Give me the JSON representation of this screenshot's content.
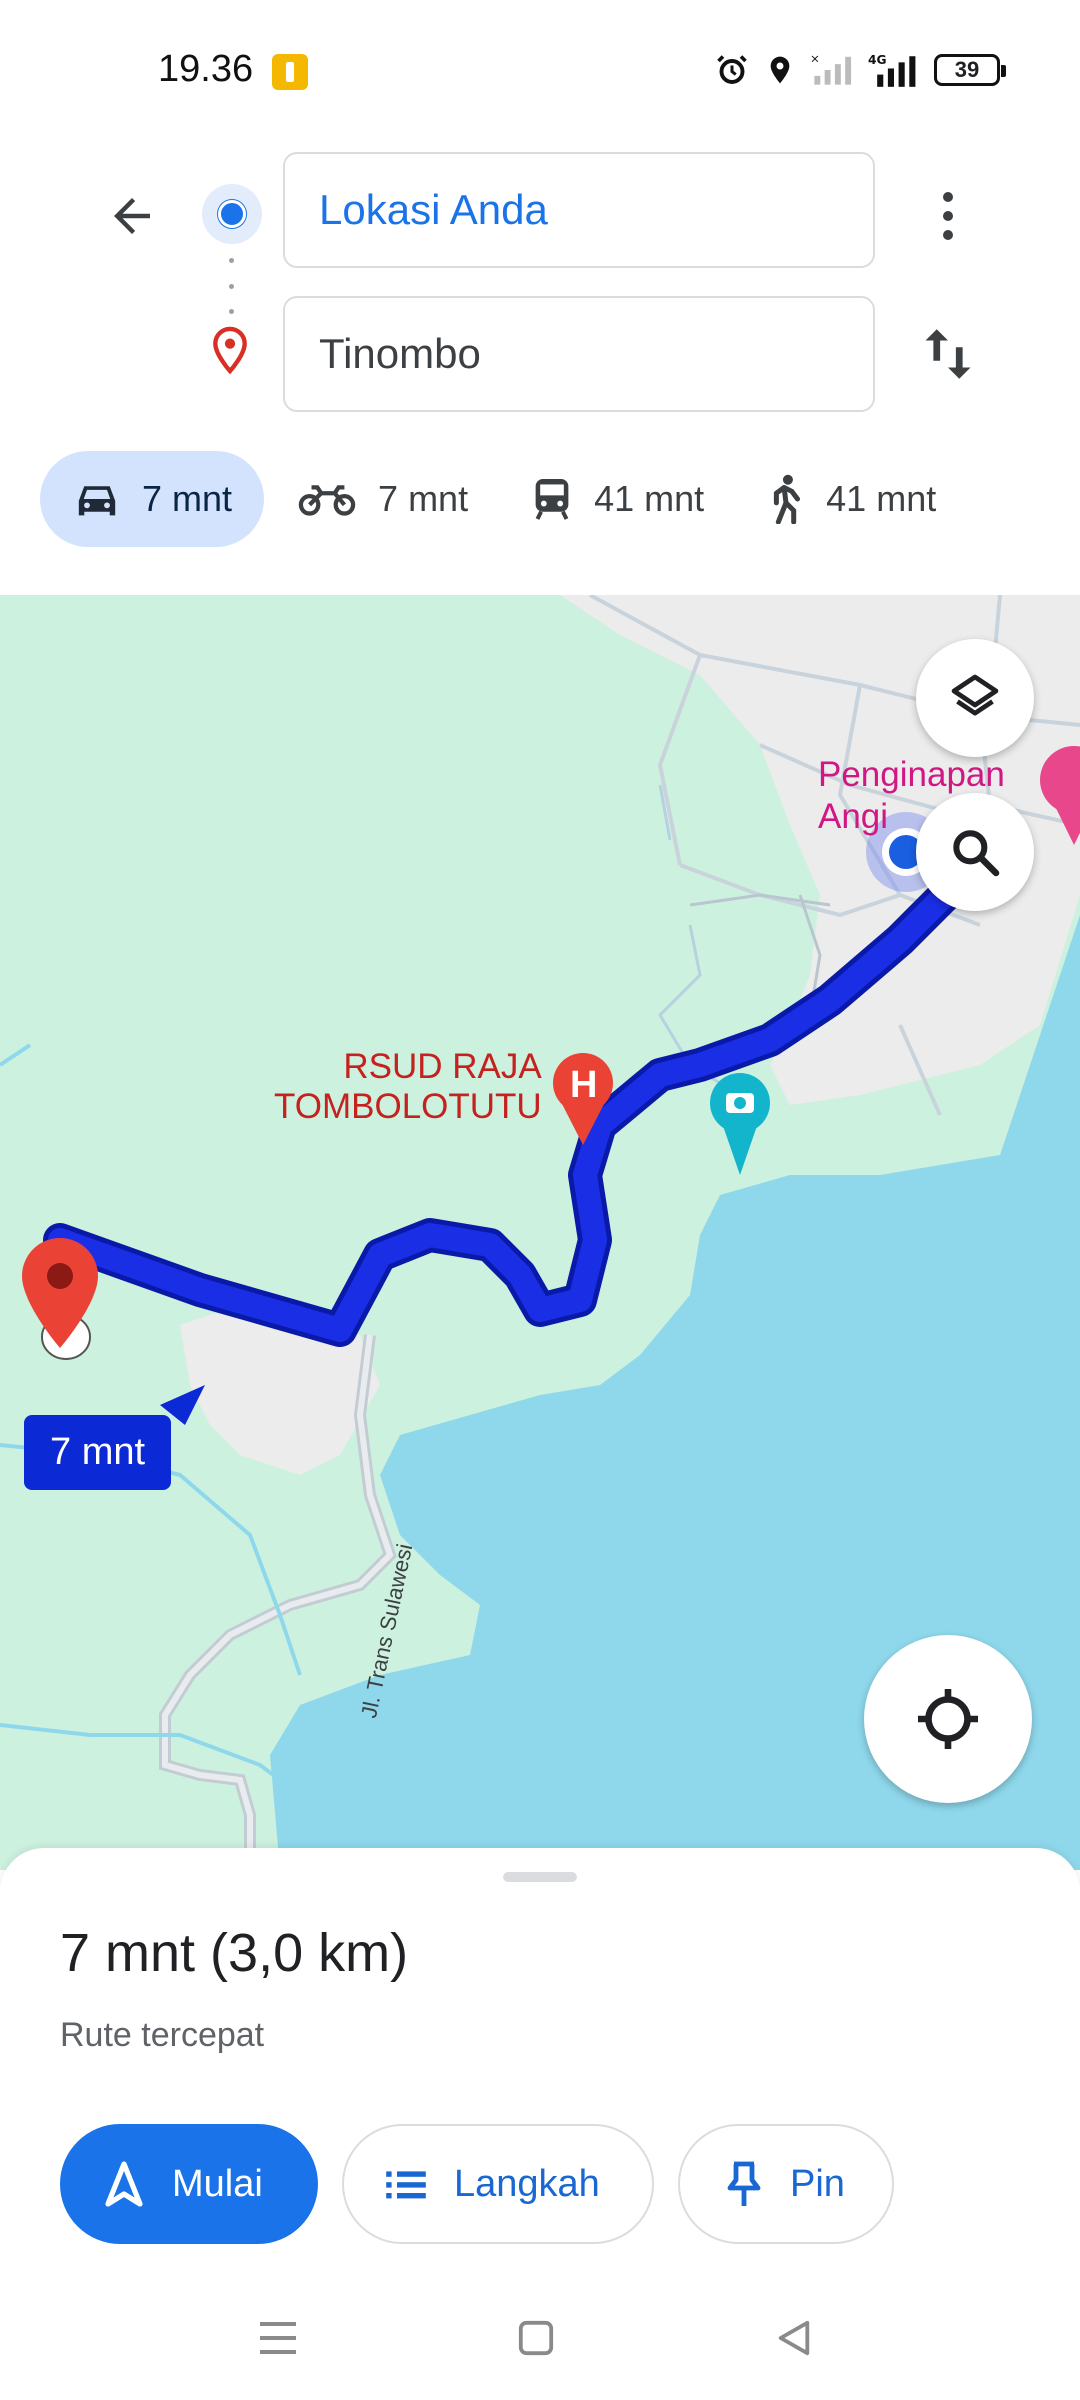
{
  "status_bar": {
    "time": "19.36",
    "battery": "39",
    "network": "4G"
  },
  "directions": {
    "origin": "Lokasi Anda",
    "destination": "Tinombo"
  },
  "travel_modes": [
    {
      "mode": "car-icon",
      "label": "7 mnt",
      "active": true
    },
    {
      "mode": "motorcycle-icon",
      "label": "7 mnt",
      "active": false
    },
    {
      "mode": "transit-icon",
      "label": "41 mnt",
      "active": false
    },
    {
      "mode": "walk-icon",
      "label": "41 mnt",
      "active": false
    }
  ],
  "map": {
    "pois": {
      "hospital_line1": "RSUD RAJA",
      "hospital_line2": "TOMBOLOTUTU",
      "lodging_line1": "Penginapan",
      "lodging_line2": "Angi"
    },
    "road_name": "Jl. Trans Sulawesi",
    "eta_badge": "7 mnt",
    "colors": {
      "route": "#1a2ee6",
      "water": "#8fd8ec",
      "land": "#cdf1df",
      "destination_pin": "#ea4335"
    }
  },
  "sheet": {
    "summary": "7 mnt (3,0 km)",
    "subtitle": "Rute tercepat",
    "buttons": {
      "start": "Mulai",
      "steps": "Langkah",
      "pin": "Pin"
    }
  }
}
